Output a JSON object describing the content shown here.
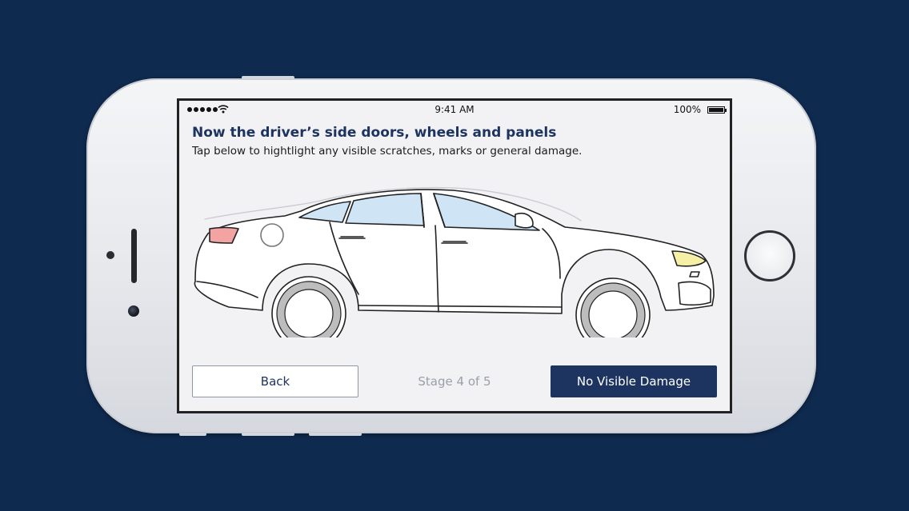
{
  "status_bar": {
    "time": "9:41 AM",
    "battery_percent": "100%",
    "signal_icon": "signal-dots-icon",
    "wifi_icon": "wifi-icon",
    "battery_icon": "battery-icon"
  },
  "header": {
    "title": "Now the driver’s side doors, wheels and panels",
    "subtitle": "Tap below to hightlight any visible scratches, marks or general damage."
  },
  "diagram": {
    "icon": "car-side-view",
    "highlight_colors": {
      "tail_light": "#f4a3a3",
      "head_light": "#f5f0a6",
      "windows": "#cfe4f5"
    }
  },
  "footer": {
    "back_label": "Back",
    "stage_label": "Stage 4 of 5",
    "no_damage_label": "No Visible Damage"
  },
  "colors": {
    "background": "#0f2a4f",
    "accent": "#1d3461"
  }
}
